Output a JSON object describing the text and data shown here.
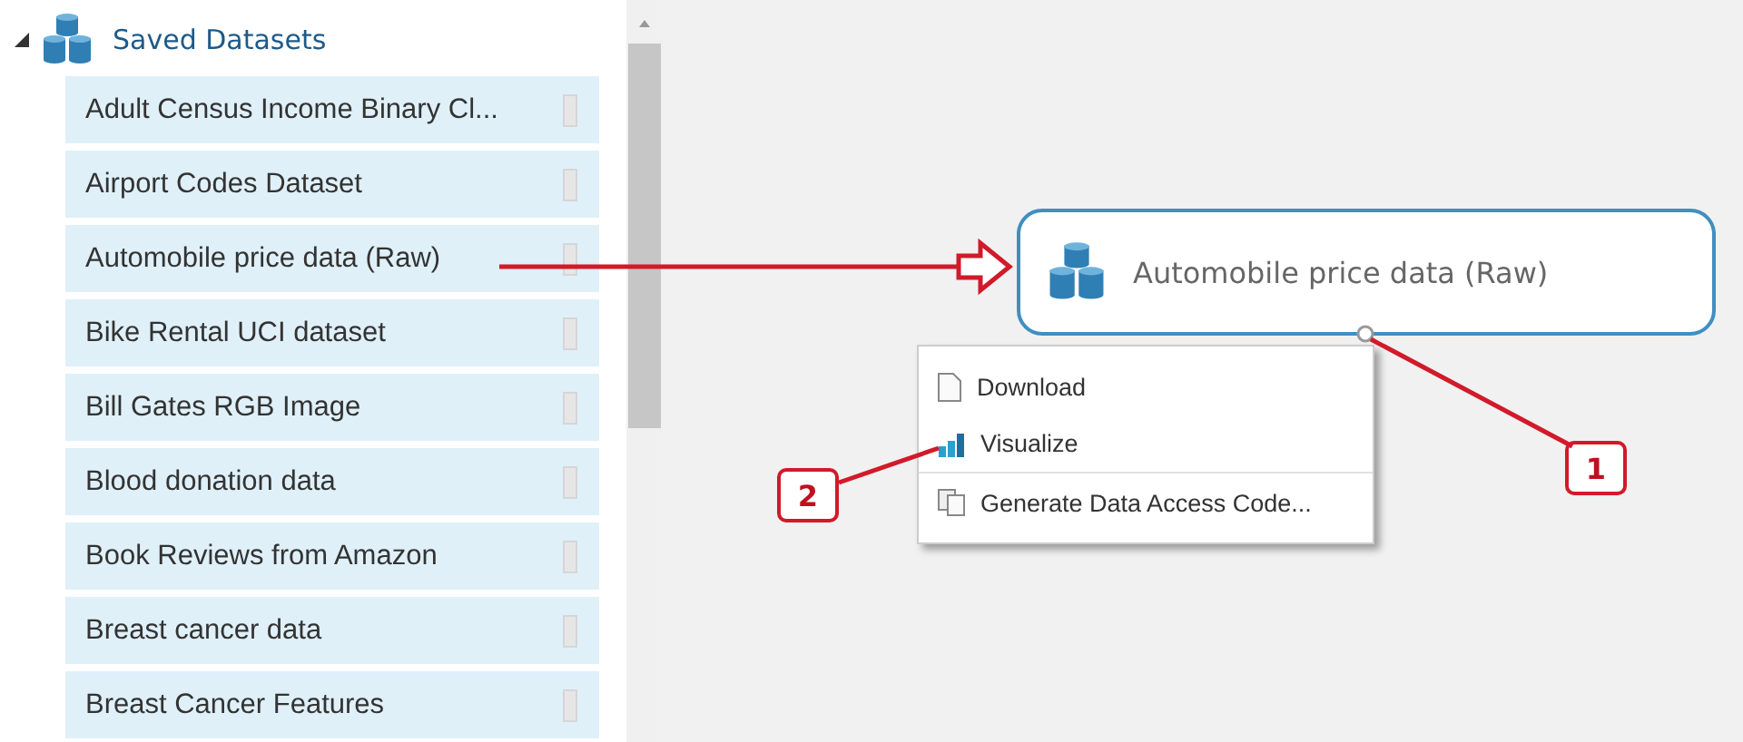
{
  "tree": {
    "label": "Saved Datasets",
    "expanded": true,
    "items": [
      {
        "label": "Adult Census Income Binary Cl..."
      },
      {
        "label": "Airport Codes Dataset"
      },
      {
        "label": "Automobile price data (Raw)"
      },
      {
        "label": "Bike Rental UCI dataset"
      },
      {
        "label": "Bill Gates RGB Image"
      },
      {
        "label": "Blood donation data"
      },
      {
        "label": "Book Reviews from Amazon"
      },
      {
        "label": "Breast cancer data"
      },
      {
        "label": "Breast Cancer Features"
      }
    ]
  },
  "node": {
    "label": "Automobile price data (Raw)"
  },
  "context_menu": {
    "items": [
      {
        "label": "Download",
        "kind": "document"
      },
      {
        "label": "Visualize",
        "kind": "chart"
      },
      {
        "label": "Generate Data Access Code...",
        "kind": "code"
      }
    ]
  },
  "callouts": [
    {
      "label": "1"
    },
    {
      "label": "2"
    }
  ]
}
